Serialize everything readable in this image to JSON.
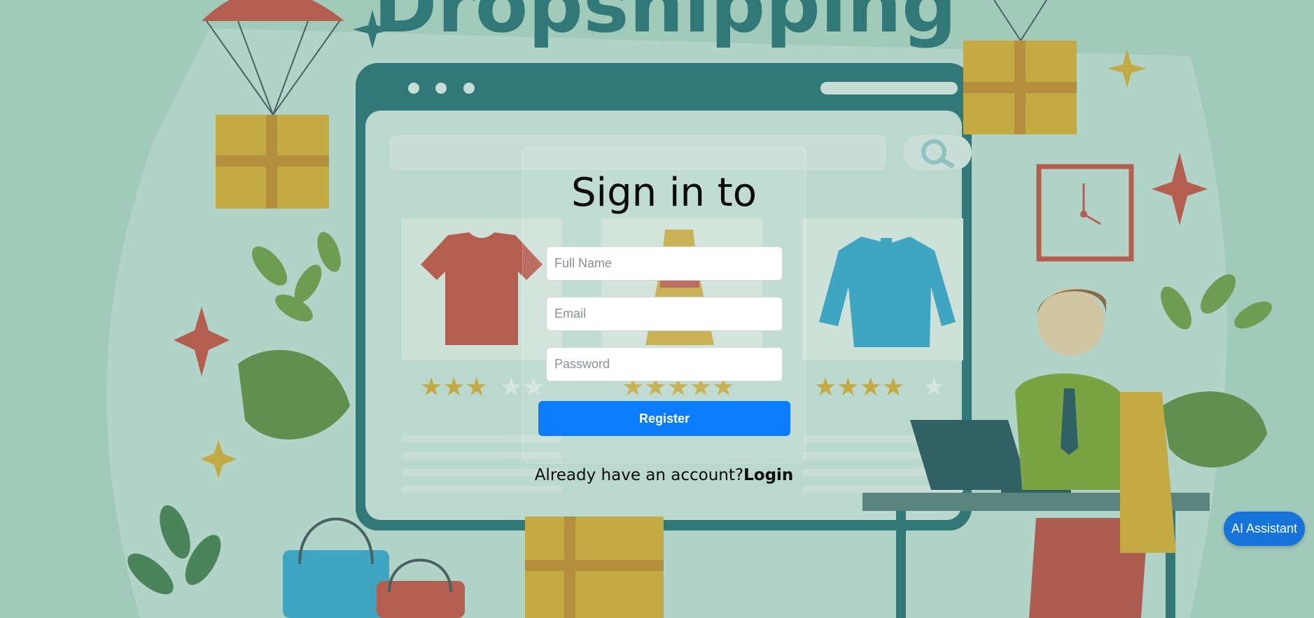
{
  "background": {
    "brand_text": "Dropshipping",
    "colors": {
      "teal": "#0c5e63",
      "gold": "#d4a21a",
      "red": "#c0392b",
      "green": "#5f8f2e"
    }
  },
  "form": {
    "title": "Sign in to",
    "full_name_placeholder": "Full Name",
    "email_placeholder": "Email",
    "password_placeholder": "Password",
    "register_label": "Register",
    "footer_text": "Already have an account?",
    "login_link": "Login"
  },
  "assistant": {
    "label": "AI Assistant"
  },
  "colors": {
    "primary": "#0b7cff",
    "assistant": "#1673d9"
  }
}
